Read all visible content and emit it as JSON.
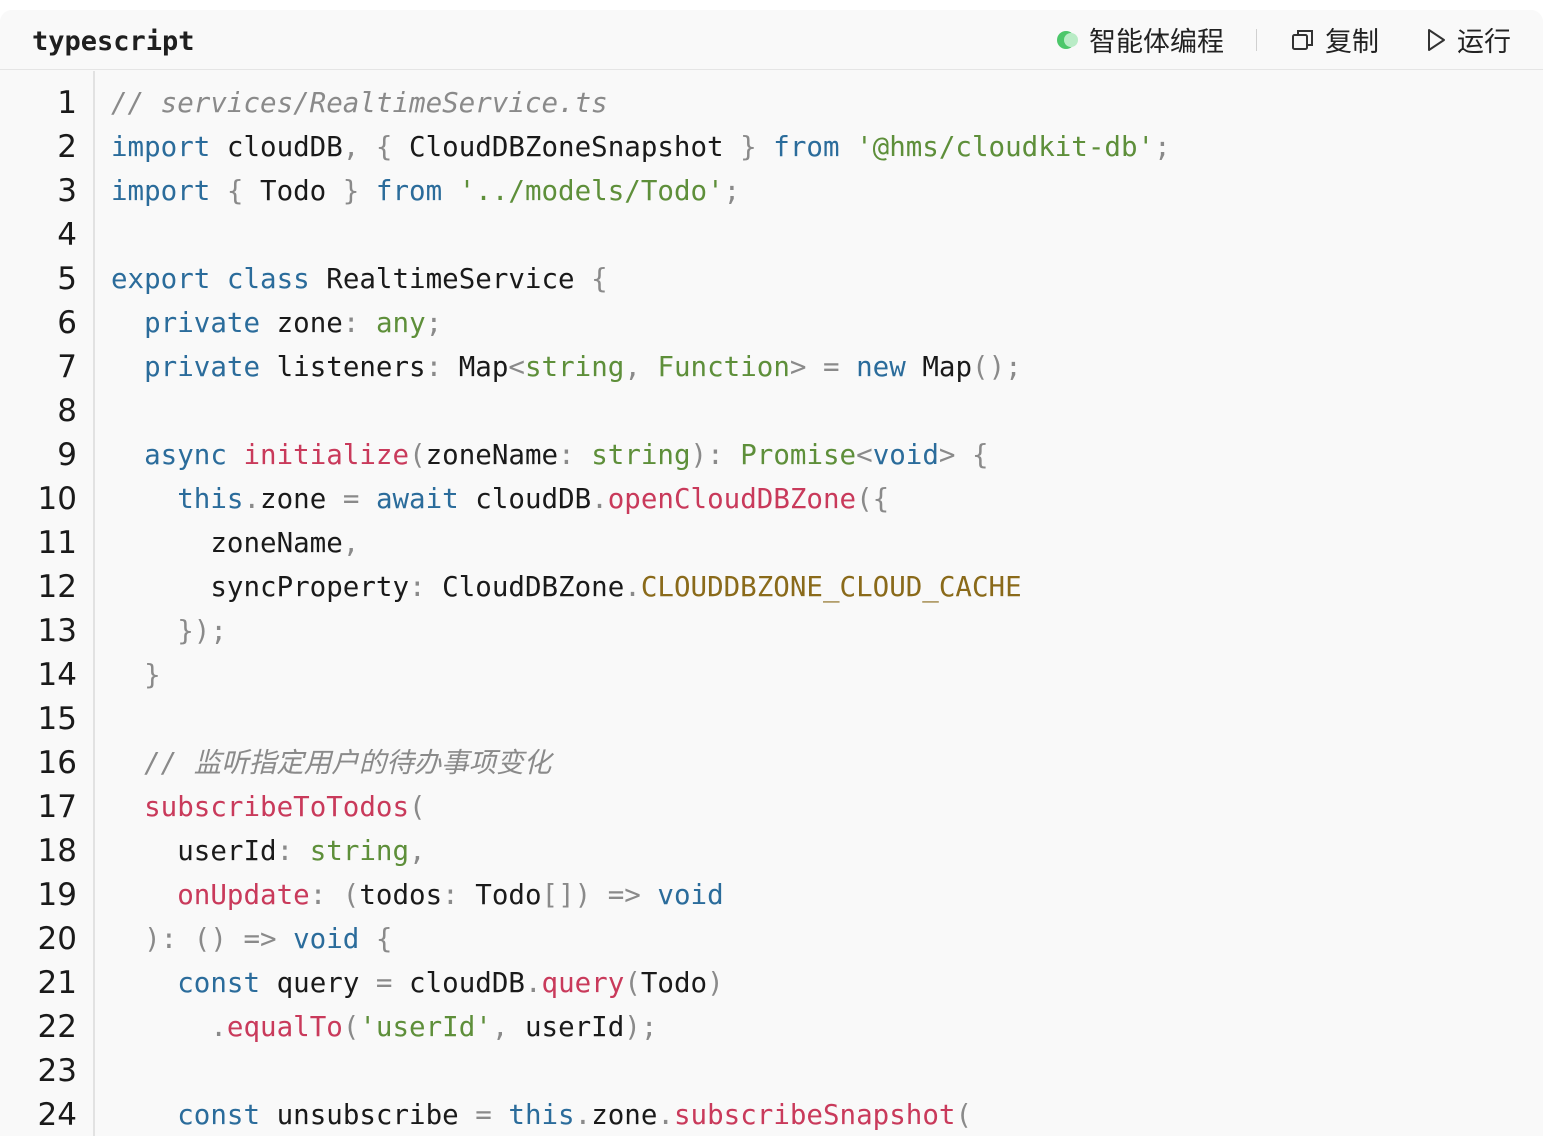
{
  "header": {
    "language": "typescript",
    "agent_label": "智能体编程",
    "copy_label": "复制",
    "run_label": "运行"
  },
  "colors": {
    "keyword": "#2b6c9b",
    "string": "#5e8f3a",
    "function": "#c93a5b",
    "comment": "#8a8a8a",
    "constant": "#8a6a1a"
  },
  "code": {
    "lines": [
      {
        "n": "1",
        "tokens": [
          [
            "cm",
            "// services/RealtimeService.ts"
          ]
        ]
      },
      {
        "n": "2",
        "tokens": [
          [
            "kw",
            "import"
          ],
          [
            "id",
            " cloudDB"
          ],
          [
            "p",
            ", { "
          ],
          [
            "id",
            "CloudDBZoneSnapshot"
          ],
          [
            "p",
            " } "
          ],
          [
            "kw",
            "from"
          ],
          [
            "p",
            " "
          ],
          [
            "str",
            "'@hms/cloudkit-db'"
          ],
          [
            "p",
            ";"
          ]
        ]
      },
      {
        "n": "3",
        "tokens": [
          [
            "kw",
            "import"
          ],
          [
            "p",
            " { "
          ],
          [
            "id",
            "Todo"
          ],
          [
            "p",
            " } "
          ],
          [
            "kw",
            "from"
          ],
          [
            "p",
            " "
          ],
          [
            "str",
            "'../models/Todo'"
          ],
          [
            "p",
            ";"
          ]
        ]
      },
      {
        "n": "4",
        "tokens": []
      },
      {
        "n": "5",
        "tokens": [
          [
            "kw",
            "export"
          ],
          [
            "p",
            " "
          ],
          [
            "kw",
            "class"
          ],
          [
            "id",
            " RealtimeService"
          ],
          [
            "p",
            " {"
          ]
        ]
      },
      {
        "n": "6",
        "tokens": [
          [
            "p",
            "  "
          ],
          [
            "kw",
            "private"
          ],
          [
            "id",
            " zone"
          ],
          [
            "p",
            ": "
          ],
          [
            "ty",
            "any"
          ],
          [
            "p",
            ";"
          ]
        ]
      },
      {
        "n": "7",
        "tokens": [
          [
            "p",
            "  "
          ],
          [
            "kw",
            "private"
          ],
          [
            "id",
            " listeners"
          ],
          [
            "p",
            ": "
          ],
          [
            "id",
            "Map"
          ],
          [
            "p",
            "<"
          ],
          [
            "ty",
            "string"
          ],
          [
            "p",
            ", "
          ],
          [
            "ty",
            "Function"
          ],
          [
            "p",
            "> = "
          ],
          [
            "kw",
            "new"
          ],
          [
            "id",
            " Map"
          ],
          [
            "p",
            "();"
          ]
        ]
      },
      {
        "n": "8",
        "tokens": []
      },
      {
        "n": "9",
        "tokens": [
          [
            "p",
            "  "
          ],
          [
            "kw",
            "async"
          ],
          [
            "p",
            " "
          ],
          [
            "fn",
            "initialize"
          ],
          [
            "p",
            "("
          ],
          [
            "id",
            "zoneName"
          ],
          [
            "p",
            ": "
          ],
          [
            "ty",
            "string"
          ],
          [
            "p",
            "): "
          ],
          [
            "ty",
            "Promise"
          ],
          [
            "p",
            "<"
          ],
          [
            "kw",
            "void"
          ],
          [
            "p",
            "> {"
          ]
        ]
      },
      {
        "n": "10",
        "tokens": [
          [
            "p",
            "    "
          ],
          [
            "kw",
            "this"
          ],
          [
            "p",
            "."
          ],
          [
            "id",
            "zone"
          ],
          [
            "p",
            " = "
          ],
          [
            "kw",
            "await"
          ],
          [
            "id",
            " cloudDB"
          ],
          [
            "p",
            "."
          ],
          [
            "fn",
            "openCloudDBZone"
          ],
          [
            "p",
            "({"
          ]
        ]
      },
      {
        "n": "11",
        "tokens": [
          [
            "p",
            "      "
          ],
          [
            "id",
            "zoneName"
          ],
          [
            "p",
            ","
          ]
        ]
      },
      {
        "n": "12",
        "tokens": [
          [
            "p",
            "      "
          ],
          [
            "id",
            "syncProperty"
          ],
          [
            "p",
            ": "
          ],
          [
            "id",
            "CloudDBZone"
          ],
          [
            "p",
            "."
          ],
          [
            "const",
            "CLOUDDBZONE_CLOUD_CACHE"
          ]
        ]
      },
      {
        "n": "13",
        "tokens": [
          [
            "p",
            "    });"
          ]
        ]
      },
      {
        "n": "14",
        "tokens": [
          [
            "p",
            "  }"
          ]
        ]
      },
      {
        "n": "15",
        "tokens": []
      },
      {
        "n": "16",
        "tokens": [
          [
            "p",
            "  "
          ],
          [
            "cm",
            "// 监听指定用户的待办事项变化"
          ]
        ]
      },
      {
        "n": "17",
        "tokens": [
          [
            "p",
            "  "
          ],
          [
            "fn",
            "subscribeToTodos"
          ],
          [
            "p",
            "("
          ]
        ]
      },
      {
        "n": "18",
        "tokens": [
          [
            "p",
            "    "
          ],
          [
            "id",
            "userId"
          ],
          [
            "p",
            ": "
          ],
          [
            "ty",
            "string"
          ],
          [
            "p",
            ","
          ]
        ]
      },
      {
        "n": "19",
        "tokens": [
          [
            "p",
            "    "
          ],
          [
            "fn",
            "onUpdate"
          ],
          [
            "p",
            ": ("
          ],
          [
            "id",
            "todos"
          ],
          [
            "p",
            ": "
          ],
          [
            "id",
            "Todo"
          ],
          [
            "p",
            "[]) => "
          ],
          [
            "kw",
            "void"
          ]
        ]
      },
      {
        "n": "20",
        "tokens": [
          [
            "p",
            "  ): () => "
          ],
          [
            "kw",
            "void"
          ],
          [
            "p",
            " {"
          ]
        ]
      },
      {
        "n": "21",
        "tokens": [
          [
            "p",
            "    "
          ],
          [
            "kw",
            "const"
          ],
          [
            "id",
            " query"
          ],
          [
            "p",
            " = "
          ],
          [
            "id",
            "cloudDB"
          ],
          [
            "p",
            "."
          ],
          [
            "fn",
            "query"
          ],
          [
            "p",
            "("
          ],
          [
            "id",
            "Todo"
          ],
          [
            "p",
            ")"
          ]
        ]
      },
      {
        "n": "22",
        "tokens": [
          [
            "p",
            "      ."
          ],
          [
            "fn",
            "equalTo"
          ],
          [
            "p",
            "("
          ],
          [
            "str",
            "'userId'"
          ],
          [
            "p",
            ", "
          ],
          [
            "id",
            "userId"
          ],
          [
            "p",
            ");"
          ]
        ]
      },
      {
        "n": "23",
        "tokens": []
      },
      {
        "n": "24",
        "tokens": [
          [
            "p",
            "    "
          ],
          [
            "kw",
            "const"
          ],
          [
            "id",
            " unsubscribe"
          ],
          [
            "p",
            " = "
          ],
          [
            "kw",
            "this"
          ],
          [
            "p",
            "."
          ],
          [
            "id",
            "zone"
          ],
          [
            "p",
            "."
          ],
          [
            "fn",
            "subscribeSnapshot"
          ],
          [
            "p",
            "("
          ]
        ]
      }
    ]
  }
}
